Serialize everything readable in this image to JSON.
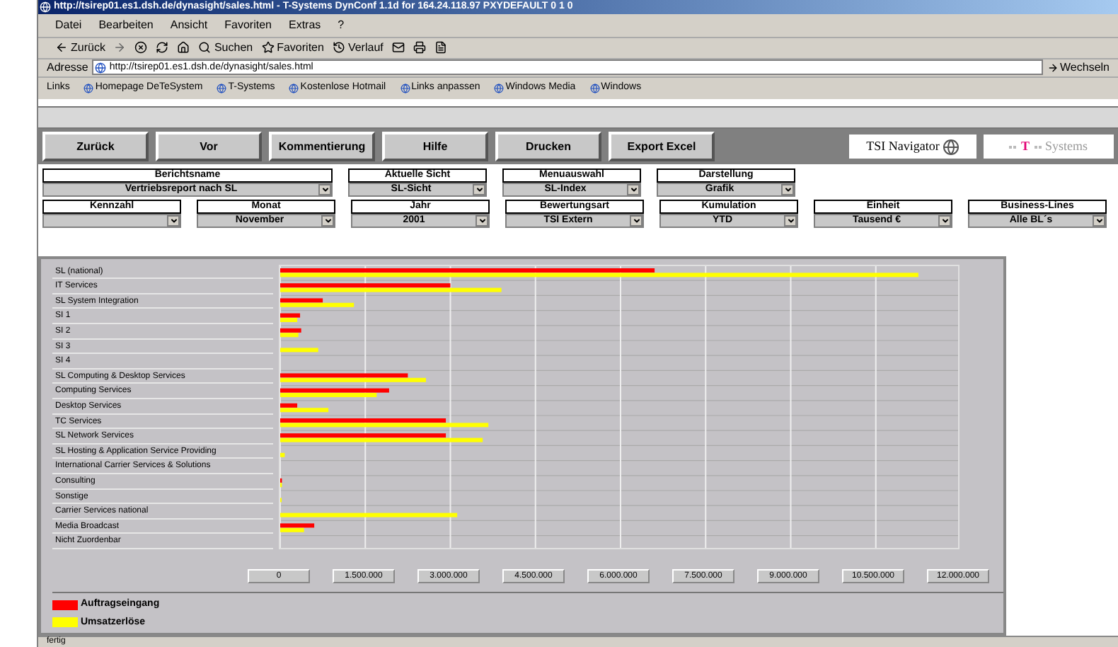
{
  "window": {
    "title": "http://tsirep01.es1.dsh.de/dynasight/sales.html - T-Systems DynConf 1.1d for 164.24.118.97 PXYDEFAULT 0 1 0"
  },
  "menu": [
    "Datei",
    "Bearbeiten",
    "Ansicht",
    "Favoriten",
    "Extras",
    "?"
  ],
  "toolbar": {
    "back": "Zurück",
    "buttons": [
      "Suchen",
      "Favoriten",
      "Verlauf"
    ]
  },
  "address_bar": {
    "label": "Adresse",
    "value": "http://tsirep01.es1.dsh.de/dynasight/sales.html",
    "go": "Wechseln"
  },
  "links_bar": {
    "label": "Links",
    "items": [
      "Homepage DeTeSystem",
      "T-Systems",
      "Kostenlose Hotmail",
      "Links anpassen",
      "Windows Media",
      "Windows"
    ]
  },
  "app_buttons": [
    "Zurück",
    "Vor",
    "Kommentierung",
    "Hilfe",
    "Drucken",
    "Export Excel"
  ],
  "navigator_logo": "TSI Navigator",
  "brand_logo": {
    "mark": "T",
    "name": "Systems"
  },
  "filters": [
    [
      {
        "label": "Berichtsname",
        "value": "Vertriebsreport nach SL",
        "wide": true
      },
      {
        "label": "Aktuelle Sicht",
        "value": "SL-Sicht"
      },
      {
        "label": "Menuauswahl",
        "value": "SL-Index"
      },
      {
        "label": "Darstellung",
        "value": "Grafik"
      }
    ],
    [
      {
        "label": "Kennzahl"
      },
      {
        "label": "Monat",
        "value": "November"
      },
      {
        "label": "Jahr",
        "value": "2001"
      },
      {
        "label": "Bewertungsart",
        "value": "TSI Extern"
      },
      {
        "label": "Kumulation",
        "value": "YTD"
      },
      {
        "label": "Einheit",
        "value": "Tausend €"
      },
      {
        "label": "Business-Lines",
        "value": "Alle BL´s"
      }
    ]
  ],
  "chart": {
    "chart_data": {
      "type": "bar",
      "orientation": "horizontal",
      "categories": [
        "SL (national)",
        "IT Services",
        "SL System Integration",
        "SI 1",
        "SI 2",
        "SI 3",
        "SI 4",
        "SL Computing & Desktop Services",
        "Computing Services",
        "Desktop Services",
        "TC Services",
        "SL Network Services",
        "SL Hosting & Application Service Providing",
        "International Carrier Services & Solutions",
        "Consulting",
        "Sonstige",
        "Carrier Services national",
        "Media Broadcast",
        "Nicht Zuordenbar"
      ],
      "series": [
        {
          "name": "Auftragseingang",
          "color": "#ff0000",
          "values": [
            6600000,
            3000000,
            750000,
            350000,
            370000,
            0,
            0,
            2250000,
            1920000,
            300000,
            2920000,
            2920000,
            0,
            0,
            30000,
            0,
            0,
            600000,
            0
          ]
        },
        {
          "name": "Umsatzerlöse",
          "color": "#ffff00",
          "values": [
            11250000,
            3900000,
            1300000,
            300000,
            320000,
            670000,
            0,
            2570000,
            1700000,
            850000,
            3670000,
            3570000,
            80000,
            0,
            30000,
            20000,
            3120000,
            420000,
            0
          ]
        }
      ],
      "xlim": [
        0,
        12000000
      ],
      "grid": true,
      "legend": true,
      "xticks": [
        {
          "value": 0,
          "label": "0"
        },
        {
          "value": 1500000,
          "label": "1.500.000"
        },
        {
          "value": 3000000,
          "label": "3.000.000"
        },
        {
          "value": 4500000,
          "label": "4.500.000"
        },
        {
          "value": 6000000,
          "label": "6.000.000"
        },
        {
          "value": 7500000,
          "label": "7.500.000"
        },
        {
          "value": 9000000,
          "label": "9.000.000"
        },
        {
          "value": 10500000,
          "label": "10.500.000"
        },
        {
          "value": 12000000,
          "label": "12.000.000"
        }
      ]
    }
  },
  "status_bar": "fertig"
}
